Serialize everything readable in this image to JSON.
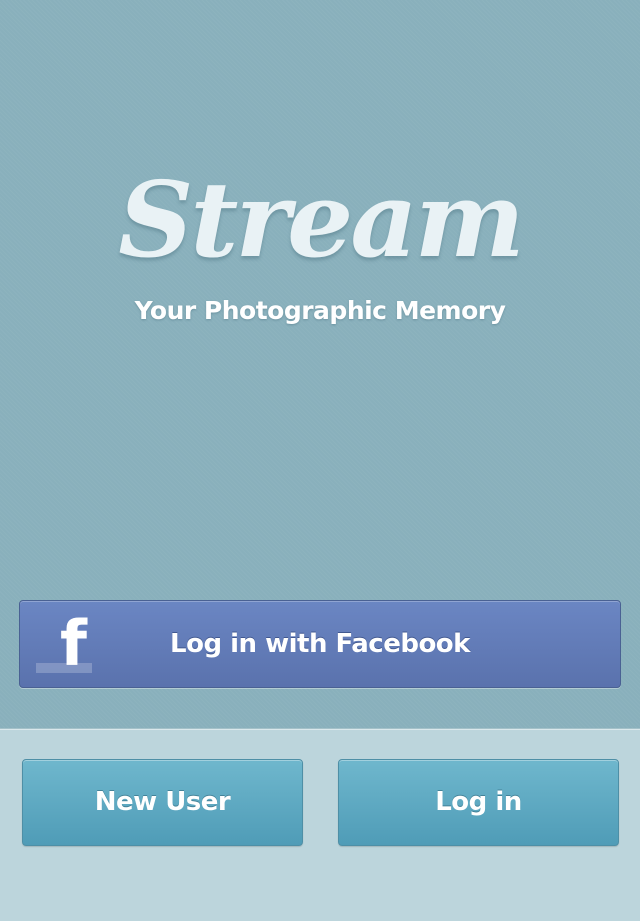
{
  "brand": {
    "logo_text": "Stream",
    "tagline": "Your Photographic Memory"
  },
  "facebook_login": {
    "icon": "facebook-f-icon",
    "icon_glyph": "f",
    "label": "Log in with Facebook"
  },
  "actions": {
    "new_user_label": "New User",
    "login_label": "Log in"
  },
  "colors": {
    "background_top": "#89b0bc",
    "background_bottom": "#bcd5dc",
    "facebook_blue": "#5f79b6",
    "button_teal": "#5aa8c2"
  }
}
